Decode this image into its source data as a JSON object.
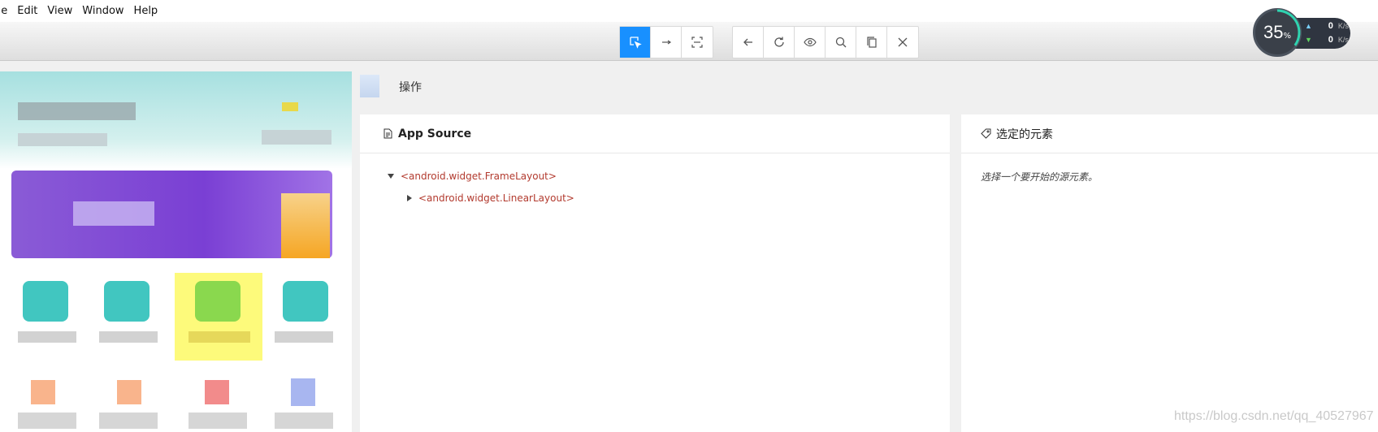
{
  "menu": [
    "ile",
    "Edit",
    "View",
    "Window",
    "Help"
  ],
  "toolbar": {
    "group1": [
      {
        "icon": "select-element-icon",
        "active": true
      },
      {
        "icon": "swipe-arrow-icon",
        "active": false
      },
      {
        "icon": "tap-coordinates-icon",
        "active": false
      }
    ],
    "group2": [
      {
        "icon": "back-arrow-icon"
      },
      {
        "icon": "refresh-icon"
      },
      {
        "icon": "eye-icon"
      },
      {
        "icon": "search-icon"
      },
      {
        "icon": "copy-icon"
      },
      {
        "icon": "close-icon"
      }
    ],
    "accent": "#1890ff"
  },
  "netmonitor": {
    "cpu_value": "35",
    "cpu_unit": "%",
    "cpu_fraction": 0.35,
    "upload": {
      "value": "0",
      "unit": "K/s"
    },
    "download": {
      "value": "0",
      "unit": "K/s"
    }
  },
  "operations": {
    "label": "操作"
  },
  "source_panel": {
    "title": "App Source",
    "tree": [
      {
        "label": "<android.widget.FrameLayout>",
        "expanded": true,
        "depth": 0
      },
      {
        "label": "<android.widget.LinearLayout>",
        "expanded": false,
        "depth": 1
      }
    ],
    "tag_color": "#b23a2e"
  },
  "selected_panel": {
    "title": "选定的元素",
    "hint": "选择一个要开始的源元素。"
  },
  "watermark": "https://blog.csdn.net/qq_40527967"
}
